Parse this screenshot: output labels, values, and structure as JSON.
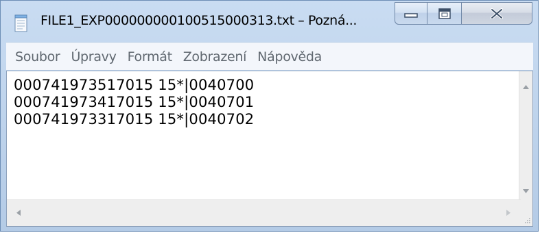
{
  "window": {
    "title": "FILE1_EXP000000000100515000313.txt – Pozná...",
    "icon": "notepad-icon"
  },
  "caption_buttons": {
    "minimize_icon": "minimize-icon",
    "maximize_icon": "maximize-icon",
    "close_icon": "close-icon"
  },
  "menu": {
    "items": [
      {
        "label": "Soubor"
      },
      {
        "label": "Úpravy"
      },
      {
        "label": "Formát"
      },
      {
        "label": "Zobrazení"
      },
      {
        "label": "Nápověda"
      }
    ]
  },
  "editor": {
    "lines": [
      "000741973517015 15*|0040700",
      "000741973417015 15*|0040701",
      "000741973317015 15*|0040702"
    ]
  },
  "colors": {
    "title_bar": "#b9d1ea",
    "menu_bar": "#f3f6fb",
    "text": "#000000",
    "menu_text": "#606870"
  }
}
